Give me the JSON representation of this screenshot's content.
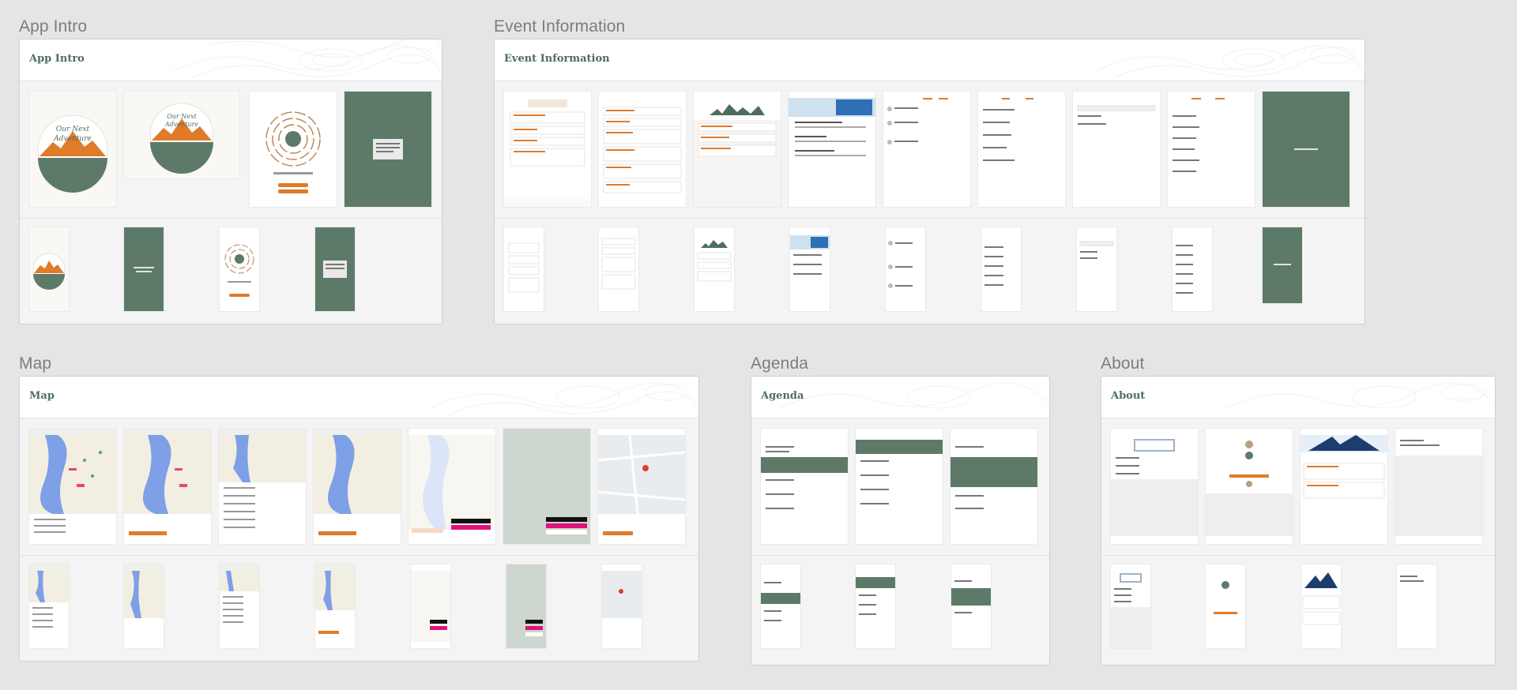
{
  "sections": {
    "app_intro": {
      "label": "App Intro",
      "title": "App Intro"
    },
    "event_information": {
      "label": "Event Information",
      "title": "Event Information"
    },
    "map": {
      "label": "Map",
      "title": "Map"
    },
    "agenda": {
      "label": "Agenda",
      "title": "Agenda"
    },
    "about": {
      "label": "About",
      "title": "About"
    }
  },
  "colors": {
    "accent": "#e07b2a",
    "brand_green": "#5d7a68",
    "label_gray": "#7d7d7d",
    "board_bg": "#f4f4f4",
    "title_green": "#4e6e5d"
  }
}
